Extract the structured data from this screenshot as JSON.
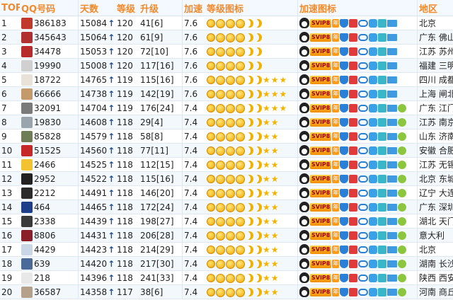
{
  "headers": {
    "top": "TOP",
    "qq": "QQ号码",
    "days": "天数",
    "level": "等级",
    "upgrade": "升级",
    "accel": "加速",
    "level_icons": "等级图标",
    "accel_icons": "加速图标",
    "region": "地区"
  },
  "colors": {
    "header_text": "#f08a2c",
    "row_alt": "#f3f8fd",
    "arrow": "#1a4f9c",
    "icon_gold": "#f2b400"
  },
  "rows": [
    {
      "rank": "1",
      "qq": "386183",
      "days": "15084",
      "level": "120",
      "upgrade": "41[6]",
      "accel": "7.6",
      "region": "北京",
      "avatar": "#c0392b",
      "stars": 0,
      "extra": false
    },
    {
      "rank": "2",
      "qq": "345643",
      "days": "15064",
      "level": "120",
      "upgrade": "61[9]",
      "accel": "7.6",
      "region": "广东 佛山",
      "avatar": "#b03030",
      "stars": 0,
      "extra": false
    },
    {
      "rank": "3",
      "qq": "34478",
      "days": "15053",
      "level": "120",
      "upgrade": "72[10]",
      "accel": "7.6",
      "region": "江苏 苏州",
      "avatar": "#b82b2b",
      "stars": 0,
      "extra": false
    },
    {
      "rank": "4",
      "qq": "19990",
      "days": "15008",
      "level": "120",
      "upgrade": "117[16]",
      "accel": "7.6",
      "region": "福建 三明",
      "avatar": "#d0d0d0",
      "stars": 0,
      "extra": false
    },
    {
      "rank": "5",
      "qq": "18722",
      "days": "14765",
      "level": "119",
      "upgrade": "115[16]",
      "accel": "7.6",
      "region": "四川 成都",
      "avatar": "#e8e2d8",
      "stars": 3,
      "extra": false
    },
    {
      "rank": "6",
      "qq": "66666",
      "days": "14738",
      "level": "119",
      "upgrade": "142[19]",
      "accel": "7.6",
      "region": "上海 闸北",
      "avatar": "#c49a6c",
      "stars": 3,
      "extra": false
    },
    {
      "rank": "7",
      "qq": "32091",
      "days": "14704",
      "level": "119",
      "upgrade": "176[24]",
      "accel": "7.4",
      "region": "广东 江门",
      "avatar": "#7a7a7a",
      "stars": 3,
      "extra": true
    },
    {
      "rank": "8",
      "qq": "19830",
      "days": "14608",
      "level": "118",
      "upgrade": "29[4]",
      "accel": "7.4",
      "region": "江苏 南京",
      "avatar": "#9aa4ad",
      "stars": 2,
      "extra": true
    },
    {
      "rank": "9",
      "qq": "85828",
      "days": "14579",
      "level": "118",
      "upgrade": "58[8]",
      "accel": "7.4",
      "region": "山东 济南",
      "avatar": "#6f7d55",
      "stars": 2,
      "extra": true
    },
    {
      "rank": "10",
      "qq": "51525",
      "days": "14560",
      "level": "118",
      "upgrade": "77[11]",
      "accel": "7.4",
      "region": "安徽 合肥",
      "avatar": "#c62828",
      "stars": 2,
      "extra": true
    },
    {
      "rank": "11",
      "qq": "2466",
      "days": "14525",
      "level": "118",
      "upgrade": "112[15]",
      "accel": "7.4",
      "region": "江苏 无锡",
      "avatar": "#f2c230",
      "stars": 2,
      "extra": true
    },
    {
      "rank": "12",
      "qq": "2952",
      "days": "14522",
      "level": "118",
      "upgrade": "115[16]",
      "accel": "7.4",
      "region": "北京 东城",
      "avatar": "#222222",
      "stars": 2,
      "extra": true
    },
    {
      "rank": "13",
      "qq": "2212",
      "days": "14491",
      "level": "118",
      "upgrade": "146[20]",
      "accel": "7.4",
      "region": "辽宁 大连",
      "avatar": "#2b2b2b",
      "stars": 2,
      "extra": true
    },
    {
      "rank": "14",
      "qq": "464",
      "days": "14465",
      "level": "118",
      "upgrade": "172[24]",
      "accel": "7.4",
      "region": "广东 深圳",
      "avatar": "#1d3f8a",
      "stars": 2,
      "extra": true
    },
    {
      "rank": "15",
      "qq": "2338",
      "days": "14439",
      "level": "118",
      "upgrade": "198[27]",
      "accel": "7.4",
      "region": "湖北 天门",
      "avatar": "#3a3a3a",
      "stars": 2,
      "extra": true
    },
    {
      "rank": "16",
      "qq": "8806",
      "days": "14431",
      "level": "118",
      "upgrade": "206[28]",
      "accel": "7.4",
      "region": "意大利",
      "avatar": "#8a1f2a",
      "stars": 2,
      "extra": true
    },
    {
      "rank": "17",
      "qq": "4429",
      "days": "14423",
      "level": "118",
      "upgrade": "214[29]",
      "accel": "7.4",
      "region": "北京",
      "avatar": "#c8d6e6",
      "stars": 2,
      "extra": true
    },
    {
      "rank": "18",
      "qq": "639",
      "days": "14420",
      "level": "118",
      "upgrade": "217[30]",
      "accel": "7.4",
      "region": "湖南 长沙",
      "avatar": "#4a6a9a",
      "stars": 2,
      "extra": true
    },
    {
      "rank": "19",
      "qq": "218",
      "days": "14396",
      "level": "118",
      "upgrade": "241[33]",
      "accel": "7.4",
      "region": "陕西 西安",
      "avatar": "#e8e8e8",
      "stars": 2,
      "extra": true
    },
    {
      "rank": "20",
      "qq": "36587",
      "days": "14358",
      "level": "117",
      "upgrade": "38[6]",
      "accel": "7.4",
      "region": "河南 商丘",
      "avatar": "#b5a08a",
      "stars": 2,
      "extra": true
    }
  ],
  "svip_label": "SVIP8",
  "year_label": "年",
  "arrow_symbol": "↑"
}
